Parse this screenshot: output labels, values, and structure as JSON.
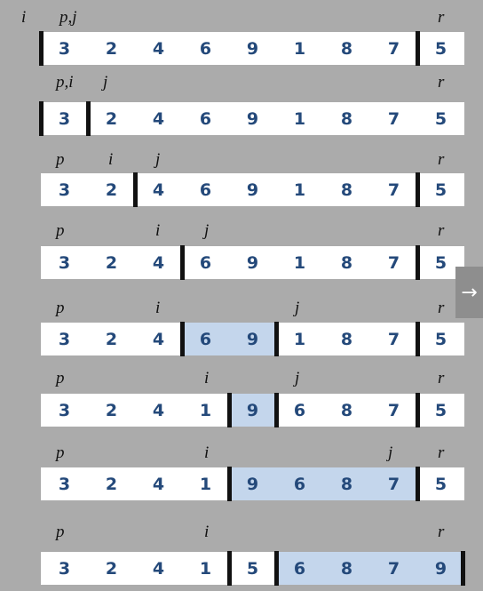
{
  "top_label": "i",
  "rows": [
    {
      "values": [
        "3",
        "2",
        "4",
        "6",
        "9",
        "1",
        "8",
        "7",
        "5"
      ],
      "labels": {
        "p": "p,j",
        "r": "r"
      }
    },
    {
      "values": [
        "3",
        "2",
        "4",
        "6",
        "9",
        "1",
        "8",
        "7",
        "5"
      ],
      "labels": {
        "p": "p,i",
        "j": "j",
        "r": "r"
      }
    },
    {
      "values": [
        "3",
        "2",
        "4",
        "6",
        "9",
        "1",
        "8",
        "7",
        "5"
      ],
      "labels": {
        "p": "p",
        "i": "i",
        "j": "j",
        "r": "r"
      }
    },
    {
      "values": [
        "3",
        "2",
        "4",
        "6",
        "9",
        "1",
        "8",
        "7",
        "5"
      ],
      "labels": {
        "p": "p",
        "i": "i",
        "j": "j",
        "r": "r"
      }
    },
    {
      "values": [
        "3",
        "2",
        "4",
        "6",
        "9",
        "1",
        "8",
        "7",
        "5"
      ],
      "labels": {
        "p": "p",
        "i": "i",
        "j": "j",
        "r": "r"
      }
    },
    {
      "values": [
        "3",
        "2",
        "4",
        "1",
        "9",
        "6",
        "8",
        "7",
        "5"
      ],
      "labels": {
        "p": "p",
        "i": "i",
        "j": "j",
        "r": "r"
      }
    },
    {
      "values": [
        "3",
        "2",
        "4",
        "1",
        "9",
        "6",
        "8",
        "7",
        "5"
      ],
      "labels": {
        "p": "p",
        "i": "i",
        "j": "j",
        "r": "r"
      }
    },
    {
      "values": [
        "3",
        "2",
        "4",
        "1",
        "5",
        "6",
        "8",
        "7",
        "9"
      ],
      "labels": {
        "p": "p",
        "i": "i",
        "r": "r"
      }
    }
  ],
  "colors": {
    "background": "#ababab",
    "cell": "#ffffff",
    "highlight": "#c4d6ec",
    "number": "#24497a",
    "divider": "#111111"
  },
  "next_button": {
    "icon": "right-arrow-icon",
    "glyph": "→"
  }
}
